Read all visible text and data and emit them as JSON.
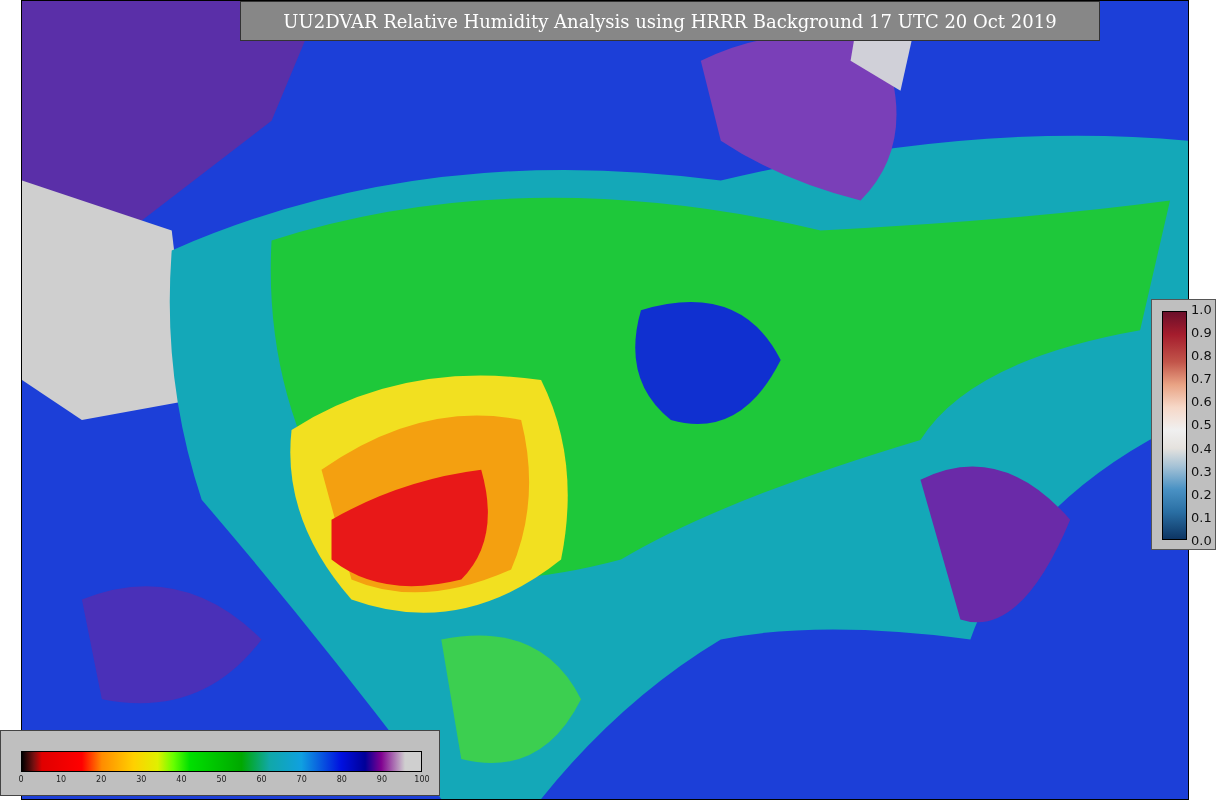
{
  "title": "UU2DVAR Relative Humidity Analysis using HRRR Background 17 UTC 20 Oct 2019",
  "humidity_colorbar": {
    "ticks": [
      "0",
      "10",
      "20",
      "30",
      "40",
      "50",
      "60",
      "70",
      "80",
      "90",
      "100"
    ]
  },
  "value_colorbar": {
    "ticks": [
      "1.0",
      "0.9",
      "0.8",
      "0.7",
      "0.6",
      "0.5",
      "0.4",
      "0.3",
      "0.2",
      "0.1",
      "0.0"
    ]
  }
}
